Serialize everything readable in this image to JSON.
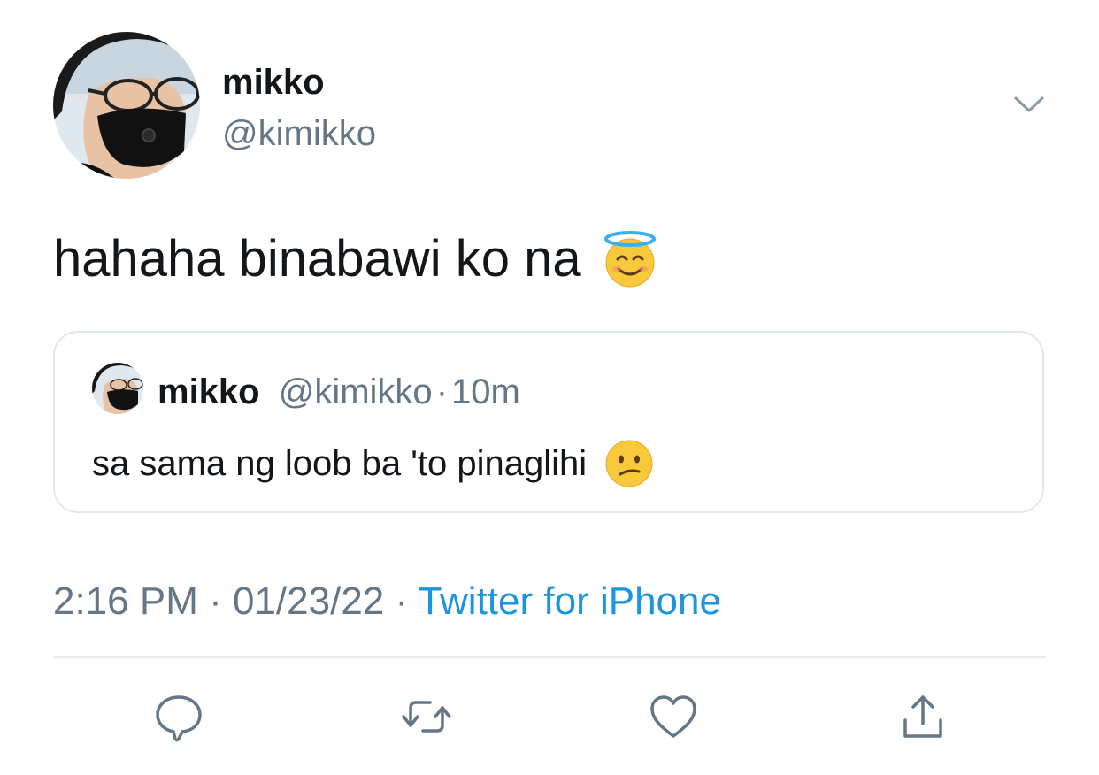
{
  "tweet": {
    "author": {
      "name": "mikko",
      "handle": "@kimikko"
    },
    "text": "hahaha binabawi ko na",
    "text_emoji": "smiling-face-with-halo",
    "quoted_tweet": {
      "author_name": "mikko",
      "author_handle": "@kimikko",
      "separator": "·",
      "time_ago": "10m",
      "text": "sa sama ng loob ba 'to pinaglihi",
      "text_emoji": "confused-face"
    },
    "meta": {
      "time": "2:16 PM",
      "separator": " · ",
      "date": "01/23/22",
      "source": "Twitter for iPhone"
    }
  },
  "actions": [
    {
      "name": "reply",
      "icon": "comment-icon"
    },
    {
      "name": "retweet",
      "icon": "retweet-icon"
    },
    {
      "name": "like",
      "icon": "heart-icon"
    },
    {
      "name": "share",
      "icon": "share-icon"
    }
  ],
  "colors": {
    "text_primary": "#14171a",
    "text_secondary": "#657786",
    "link": "#1b95e0",
    "border": "#e1e8ed",
    "icon": "#657786"
  }
}
